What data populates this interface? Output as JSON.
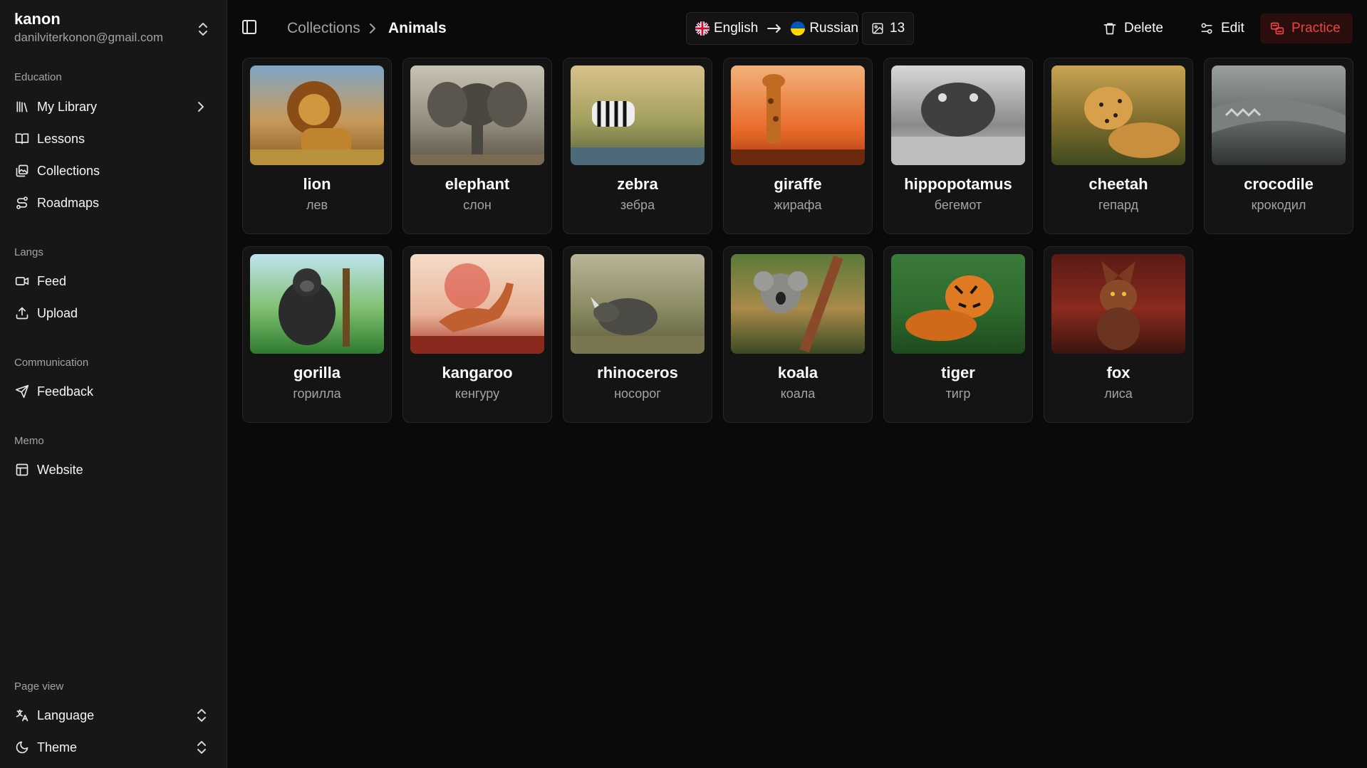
{
  "user": {
    "name": "kanon",
    "email": "danilviterkonon@gmail.com"
  },
  "sidebar": {
    "groups": [
      {
        "label": "Education",
        "items": [
          {
            "label": "My Library",
            "icon": "library-icon"
          },
          {
            "label": "Lessons",
            "icon": "book-open-icon"
          },
          {
            "label": "Collections",
            "icon": "gallery-icon"
          },
          {
            "label": "Roadmaps",
            "icon": "route-icon"
          }
        ]
      },
      {
        "label": "Langs",
        "items": [
          {
            "label": "Feed",
            "icon": "video-icon"
          },
          {
            "label": "Upload",
            "icon": "upload-icon"
          }
        ]
      },
      {
        "label": "Communication",
        "items": [
          {
            "label": "Feedback",
            "icon": "send-icon"
          }
        ]
      },
      {
        "label": "Memo",
        "items": [
          {
            "label": "Website",
            "icon": "layout-icon"
          }
        ]
      },
      {
        "label": "Page view",
        "items": [
          {
            "label": "Language",
            "icon": "translate-icon"
          },
          {
            "label": "Theme",
            "icon": "moon-icon"
          }
        ]
      }
    ]
  },
  "breadcrumb": {
    "parent": "Collections",
    "current": "Animals"
  },
  "languages": {
    "source": "English",
    "target": "Russian"
  },
  "image_count": "13",
  "actions": {
    "delete": "Delete",
    "edit": "Edit",
    "practice": "Practice"
  },
  "colors": {
    "accent": "#ef4444",
    "background": "#0a0a0a",
    "sidebar": "#171717"
  },
  "cards": [
    {
      "word": "lion",
      "translation": "лев",
      "image": "lion-image"
    },
    {
      "word": "elephant",
      "translation": "слон",
      "image": "elephant-image"
    },
    {
      "word": "zebra",
      "translation": "зебра",
      "image": "zebra-image"
    },
    {
      "word": "giraffe",
      "translation": "жирафа",
      "image": "giraffe-image"
    },
    {
      "word": "hippopotamus",
      "translation": "бегемот",
      "image": "hippopotamus-image"
    },
    {
      "word": "cheetah",
      "translation": "гепард",
      "image": "cheetah-image"
    },
    {
      "word": "crocodile",
      "translation": "крокодил",
      "image": "crocodile-image"
    },
    {
      "word": "gorilla",
      "translation": "горилла",
      "image": "gorilla-image"
    },
    {
      "word": "kangaroo",
      "translation": "кенгуру",
      "image": "kangaroo-image"
    },
    {
      "word": "rhinoceros",
      "translation": "носорог",
      "image": "rhinoceros-image"
    },
    {
      "word": "koala",
      "translation": "коала",
      "image": "koala-image"
    },
    {
      "word": "tiger",
      "translation": "тигр",
      "image": "tiger-image"
    },
    {
      "word": "fox",
      "translation": "лиса",
      "image": "fox-image"
    }
  ]
}
